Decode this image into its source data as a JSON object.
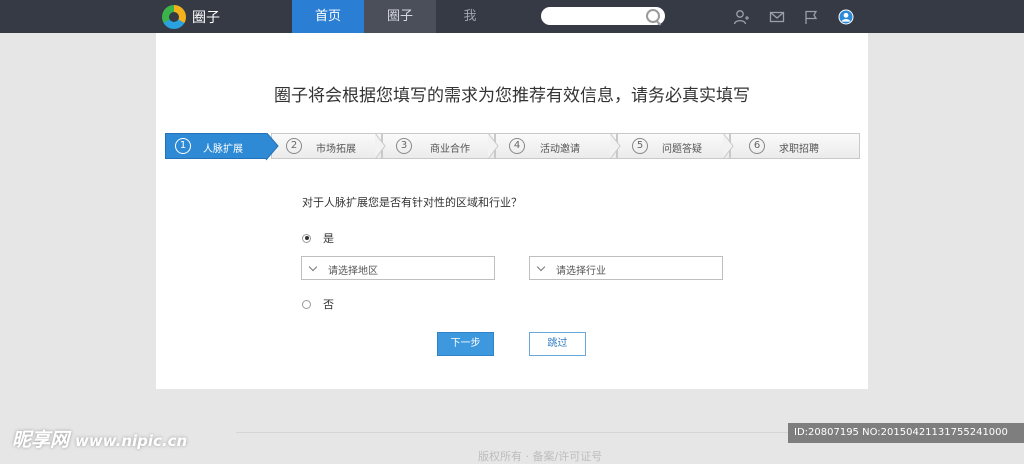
{
  "topbar": {
    "logo_text": "圈子",
    "nav": [
      {
        "label": "首页",
        "active": true
      },
      {
        "label": "圈子",
        "active": false
      },
      {
        "label": "我",
        "active": false
      }
    ],
    "search": {
      "value": "",
      "placeholder": ""
    },
    "icons": [
      "user-add-icon",
      "mail-icon",
      "flag-icon",
      "avatar-icon"
    ]
  },
  "main": {
    "headline": "圈子将会根据您填写的需求为您推荐有效信息，请务必真实填写",
    "steps": [
      {
        "num": "1",
        "label": "人脉扩展",
        "active": true
      },
      {
        "num": "2",
        "label": "市场拓展",
        "active": false
      },
      {
        "num": "3",
        "label": "商业合作",
        "active": false
      },
      {
        "num": "4",
        "label": "活动邀请",
        "active": false
      },
      {
        "num": "5",
        "label": "问题答疑",
        "active": false
      },
      {
        "num": "6",
        "label": "求职招聘",
        "active": false
      }
    ],
    "question": "对于人脉扩展您是否有针对性的区域和行业？",
    "options": [
      {
        "label": "是",
        "selected": true
      },
      {
        "label": "否",
        "selected": false
      }
    ],
    "region_select": "请选择地区",
    "industry_select": "请选择行业",
    "next_label": "下一步",
    "skip_label": "跳过"
  },
  "footer": {
    "text": "版权所有 · 备案/许可证号"
  },
  "watermark": {
    "brand": "昵享网",
    "url": "www.nipic.cn",
    "id_text": "ID:20807195 NO:20150421131755241000"
  },
  "colors": {
    "topbar": "#363a44",
    "accent": "#2a7fd4",
    "step_active": "#2f8ad6"
  }
}
